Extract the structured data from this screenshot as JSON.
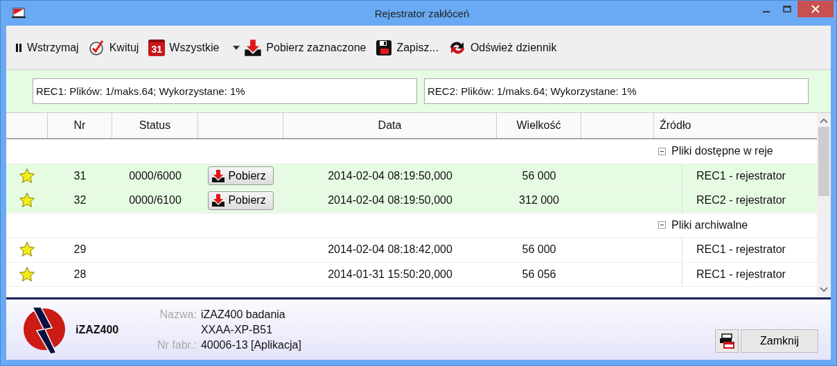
{
  "window": {
    "title": "Rejestrator zakłóceń"
  },
  "toolbar": [
    {
      "kind": "pause",
      "label": "Wstrzymaj"
    },
    {
      "kind": "check",
      "label": "Kwituj"
    },
    {
      "kind": "calendar",
      "label": "Wszystkie",
      "badge": "31",
      "dropdown": true
    },
    {
      "kind": "download",
      "label": "Pobierz zaznaczone"
    },
    {
      "kind": "save",
      "label": "Zapisz..."
    },
    {
      "kind": "refresh",
      "label": "Odśwież dziennik"
    }
  ],
  "recorders": [
    "REC1: Plików: 1/maks.64; Wykorzystane: 1%",
    "REC2: Plików: 1/maks.64; Wykorzystane: 1%"
  ],
  "table": {
    "columns": [
      "Nr",
      "Status",
      "Data",
      "Wielkość",
      "Źródło"
    ],
    "groups": [
      {
        "label": "Pliki dostępne w reje",
        "expanded": true,
        "rows": [
          {
            "starred": true,
            "highlighted": true,
            "nr": "31",
            "status": "0000/6000",
            "action": "Pobierz",
            "date": "2014-02-04 08:19:50,000",
            "size": "56 000",
            "source": "REC1 - rejestrator"
          },
          {
            "starred": true,
            "highlighted": true,
            "nr": "32",
            "status": "0000/6100",
            "action": "Pobierz",
            "date": "2014-02-04 08:19:50,000",
            "size": "312 000",
            "source": "REC2 - rejestrator"
          }
        ]
      },
      {
        "label": "Pliki archiwalne",
        "expanded": true,
        "rows": [
          {
            "starred": true,
            "highlighted": false,
            "nr": "29",
            "date": "2014-02-04 08:18:42,000",
            "size": "56 000",
            "source": "REC1 - rejestrator"
          },
          {
            "starred": true,
            "highlighted": false,
            "nr": "28",
            "date": "2014-01-31 15:50:20,000",
            "size": "56 056",
            "source": "REC1 - rejestrator"
          }
        ]
      }
    ]
  },
  "footer": {
    "device": "iZAZ400",
    "fields": [
      {
        "label": "Nazwa:",
        "value": "iZAZ400 badania"
      },
      {
        "value": "XXAA-XP-B51"
      },
      {
        "label": "Nr fabr.:",
        "value": "40006-13 [Aplikacja]"
      }
    ],
    "close_button": "Zamknij"
  }
}
